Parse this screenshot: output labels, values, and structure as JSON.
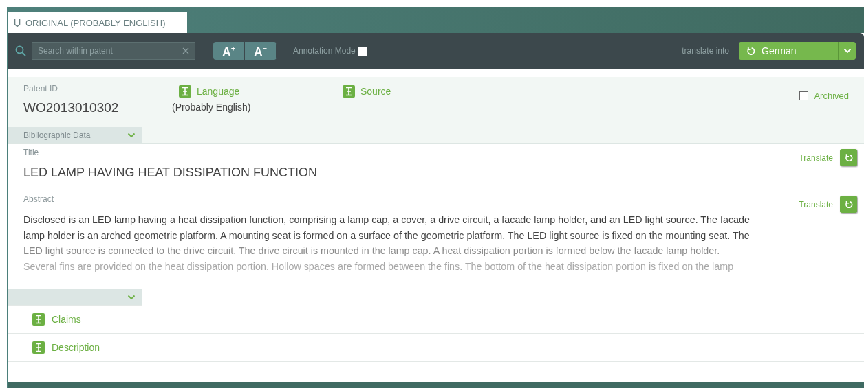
{
  "tab": {
    "label": "ORIGINAL (PROBABLY ENGLISH)",
    "selected": true
  },
  "toolbar": {
    "search": {
      "placeholder": "Search within patent"
    },
    "font_buttons": [
      "A⁺",
      "A⁻"
    ],
    "annotation_mode": {
      "label": "Annotation Mode",
      "checked": false
    },
    "translate_label": "translate into",
    "language_button": "German"
  },
  "header": {
    "patent_id_label": "Patent ID",
    "patent_id": "WO2013010302",
    "language_link": "Language",
    "language_value": "(Probably English)",
    "source_link": "Source",
    "archived": {
      "label": "Archived",
      "checked": false
    },
    "section_tab": "Bibliographic Data"
  },
  "title_section": {
    "label": "Title",
    "translate": "Translate",
    "text": "LED LAMP HAVING HEAT DISSIPATION FUNCTION"
  },
  "abstract_section": {
    "label": "Abstract",
    "translate": "Translate",
    "lines": [
      "Disclosed is an LED lamp having a heat dissipation function, comprising a lamp cap, a cover, a drive circuit, a facade lamp holder, and an LED light source. The facade",
      "lamp holder is an arched geometric platform. A mounting seat is formed on a surface of the geometric platform. The LED light source is fixed on the mounting seat. The",
      "LED light source is connected to the drive circuit. The drive circuit is mounted in the lamp cap. A heat dissipation portion is formed below the facade lamp holder.",
      "Several fins are provided on the heat dissipation portion. Hollow spaces are formed between the fins. The bottom of the heat dissipation portion is fixed on the lamp"
    ]
  },
  "sections": [
    {
      "label": "Claims"
    },
    {
      "label": "Description"
    }
  ]
}
